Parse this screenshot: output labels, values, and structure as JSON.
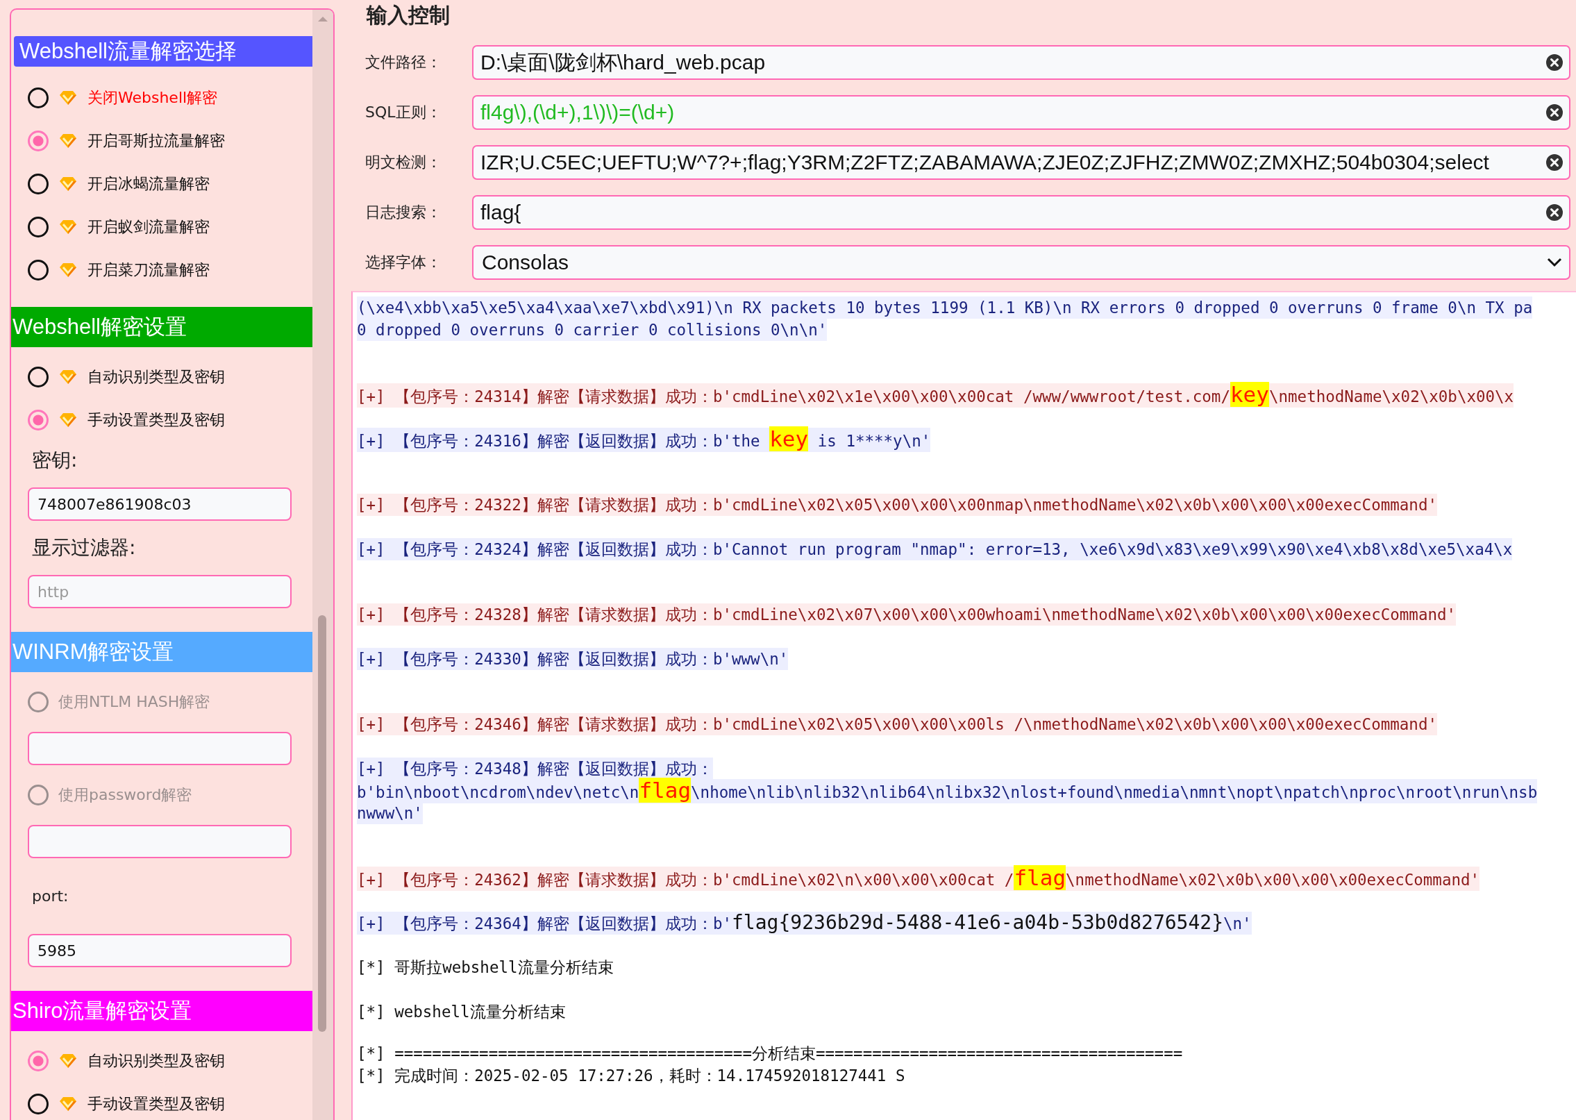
{
  "sidebar": {
    "sections": [
      {
        "title": "Webshell流量解密选择",
        "color": "#5555ff",
        "items": [
          {
            "kind": "radio",
            "label": "关闭Webshell解密",
            "selected": false,
            "disabled": false,
            "color": "#ff0000"
          },
          {
            "kind": "radio",
            "label": "开启哥斯拉流量解密",
            "selected": true,
            "disabled": false,
            "color": "#111111"
          },
          {
            "kind": "radio",
            "label": "开启冰蝎流量解密",
            "selected": false,
            "disabled": false,
            "color": "#111111"
          },
          {
            "kind": "radio",
            "label": "开启蚁剑流量解密",
            "selected": false,
            "disabled": false,
            "color": "#111111"
          },
          {
            "kind": "radio",
            "label": "开启菜刀流量解密",
            "selected": false,
            "disabled": false,
            "color": "#111111"
          }
        ]
      },
      {
        "title": "Webshell解密设置",
        "color": "#00aa00",
        "items": [
          {
            "kind": "radio",
            "label": "自动识别类型及密钥",
            "selected": false,
            "disabled": false
          },
          {
            "kind": "radio",
            "label": "手动设置类型及密钥",
            "selected": true,
            "disabled": false
          },
          {
            "kind": "label",
            "label": "密钥:"
          },
          {
            "kind": "input",
            "value": "748007e861908c03"
          },
          {
            "kind": "label",
            "label": "显示过滤器:"
          },
          {
            "kind": "input",
            "placeholder": "http"
          }
        ]
      },
      {
        "title": "WINRM解密设置",
        "color": "#55aaff",
        "items": [
          {
            "kind": "radio",
            "label": "使用NTLM HASH解密",
            "selected": false,
            "disabled": true
          },
          {
            "kind": "input"
          },
          {
            "kind": "radio",
            "label": "使用password解密",
            "selected": false,
            "disabled": true
          },
          {
            "kind": "input"
          },
          {
            "kind": "small_label",
            "label": "port:"
          },
          {
            "kind": "input",
            "value": "5985"
          }
        ]
      },
      {
        "title": "Shiro流量解密设置",
        "color": "#ff00ff",
        "items": [
          {
            "kind": "radio",
            "label": "自动识别类型及密钥",
            "selected": true,
            "disabled": false
          },
          {
            "kind": "radio",
            "label": "手动设置类型及密钥",
            "selected": false,
            "disabled": false
          }
        ]
      }
    ]
  },
  "input_control": {
    "title": "输入控制",
    "fields": [
      {
        "kind": "text",
        "label": "文件路径：",
        "value": "D:\\桌面\\陇剑杯\\hard_web.pcap",
        "color": "#111111"
      },
      {
        "kind": "text",
        "label": "SQL正则：",
        "value": "fl4g\\),(\\d+),1\\)\\)=(\\d+)",
        "color": "#22bb22"
      },
      {
        "kind": "text",
        "label": "明文检测：",
        "value": "IZR;U.C5EC;UEFTU;W^7?+;flag;Y3RM;Z2FTZ;ZABAMAWA;ZJE0Z;ZJFHZ;ZMW0Z;ZMXHZ;504b0304;select",
        "color": "#111111"
      },
      {
        "kind": "text",
        "label": "日志搜索：",
        "value": "flag{",
        "color": "#111111"
      },
      {
        "kind": "select",
        "label": "选择字体：",
        "value": "Consolas"
      }
    ]
  },
  "log": [
    {
      "kind": "raw",
      "lines": [
        [
          {
            "text": "(\\xe4\\xbb\\xa5\\xe5\\xa4\\xaa\\xe7\\xbd\\x91)\\n RX packets 10 bytes 1199 (1.1 KB)\\n RX errors 0 dropped 0 overruns 0 frame 0\\n TX pa",
            "highlight": false
          }
        ],
        [
          {
            "text": "0 dropped 0 overruns 0 carrier 0 collisions 0\\n\\n'",
            "highlight": false
          }
        ]
      ]
    },
    {
      "kind": "request",
      "lines": [
        [
          {
            "text": "[+] 【包序号：24314】解密【请求数据】成功：b'cmdLine\\x02\\x1e\\x00\\x00\\x00cat /www/wwwroot/test.com/",
            "highlight": false
          },
          {
            "text": "key",
            "highlight": true
          },
          {
            "text": "\\nmethodName\\x02\\x0b\\x00\\x",
            "highlight": false
          }
        ]
      ]
    },
    {
      "kind": "response",
      "lines": [
        [
          {
            "text": "[+] 【包序号：24316】解密【返回数据】成功：b'the ",
            "highlight": false
          },
          {
            "text": "key",
            "highlight": true
          },
          {
            "text": " is 1****y\\n'",
            "highlight": false
          }
        ]
      ]
    },
    {
      "kind": "request",
      "lines": [
        [
          {
            "text": "[+] 【包序号：24322】解密【请求数据】成功：b'cmdLine\\x02\\x05\\x00\\x00\\x00nmap\\nmethodName\\x02\\x0b\\x00\\x00\\x00execCommand'",
            "highlight": false
          }
        ]
      ]
    },
    {
      "kind": "response",
      "lines": [
        [
          {
            "text": "[+] 【包序号：24324】解密【返回数据】成功：b'Cannot run program \"nmap\": error=13, \\xe6\\x9d\\x83\\xe9\\x99\\x90\\xe4\\xb8\\x8d\\xe5\\xa4\\x",
            "highlight": false
          }
        ]
      ]
    },
    {
      "kind": "request",
      "lines": [
        [
          {
            "text": "[+] 【包序号：24328】解密【请求数据】成功：b'cmdLine\\x02\\x07\\x00\\x00\\x00whoami\\nmethodName\\x02\\x0b\\x00\\x00\\x00execCommand'",
            "highlight": false
          }
        ]
      ]
    },
    {
      "kind": "response",
      "lines": [
        [
          {
            "text": "[+] 【包序号：24330】解密【返回数据】成功：b'www\\n'",
            "highlight": false
          }
        ]
      ]
    },
    {
      "kind": "request",
      "lines": [
        [
          {
            "text": "[+] 【包序号：24346】解密【请求数据】成功：b'cmdLine\\x02\\x05\\x00\\x00\\x00ls /\\nmethodName\\x02\\x0b\\x00\\x00\\x00execCommand'",
            "highlight": false
          }
        ]
      ]
    },
    {
      "kind": "response",
      "lines": [
        [
          {
            "text": "[+] 【包序号：24348】解密【返回数据】成功：",
            "highlight": false
          }
        ],
        [
          {
            "text": "b'bin\\nboot\\ncdrom\\ndev\\netc\\n",
            "highlight": false
          },
          {
            "text": "flag",
            "highlight": true
          },
          {
            "text": "\\nhome\\nlib\\nlib32\\nlib64\\nlibx32\\nlost+found\\nmedia\\nmnt\\nopt\\npatch\\nproc\\nroot\\nrun\\nsb",
            "highlight": false
          }
        ],
        [
          {
            "text": "nwww\\n'",
            "highlight": false
          }
        ]
      ]
    },
    {
      "kind": "request",
      "lines": [
        [
          {
            "text": "[+] 【包序号：24362】解密【请求数据】成功：b'cmdLine\\x02\\n\\x00\\x00\\x00cat /",
            "highlight": false
          },
          {
            "text": "flag",
            "highlight": true
          },
          {
            "text": "\\nmethodName\\x02\\x0b\\x00\\x00\\x00execCommand'",
            "highlight": false
          }
        ]
      ]
    },
    {
      "kind": "response",
      "lines": [
        [
          {
            "text": "[+] 【包序号：24364】解密【返回数据】成功：b'",
            "highlight": false
          },
          {
            "text": "flag{9236b29d-5488-41e6-a04b-53b0d8276542}",
            "highlight": false,
            "kind": "large"
          },
          {
            "text": "\\n'",
            "highlight": false
          }
        ]
      ]
    },
    {
      "kind": "info",
      "lines": [
        [
          {
            "text": "[*] 哥斯拉webshell流量分析结束",
            "highlight": false
          }
        ]
      ]
    },
    {
      "kind": "info",
      "lines": [
        [
          {
            "text": "[*] webshell流量分析结束",
            "highlight": false
          }
        ]
      ]
    },
    {
      "kind": "summary",
      "lines": [
        [
          {
            "text": "[*] ======================================分析结束=======================================",
            "highlight": false
          }
        ],
        [
          {
            "text": "[*] 完成时间：2025-02-05 17:27:26，耗时：14.174592018127441 S",
            "highlight": false
          }
        ]
      ]
    }
  ]
}
